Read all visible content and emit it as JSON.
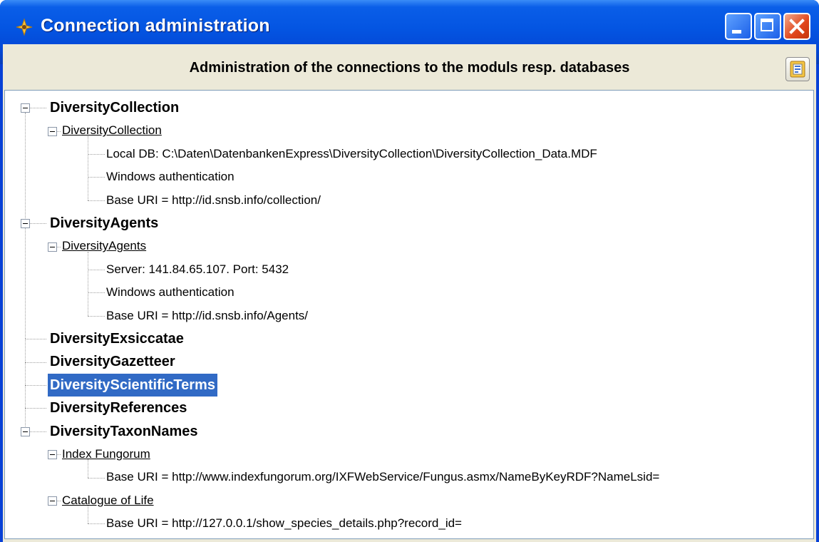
{
  "window": {
    "title": "Connection administration",
    "buttons": {
      "minimize": "minimize-icon",
      "maximize": "maximize-icon",
      "close": "close-icon"
    }
  },
  "header": {
    "text": "Administration of  the connections to the moduls resp. databases",
    "button_icon": "form-icon"
  },
  "tree": [
    {
      "label": "DiversityCollection",
      "expanded": true,
      "children": [
        {
          "label": "DiversityCollection",
          "expanded": true,
          "details": [
            "Local DB: C:\\Daten\\DatenbankenExpress\\DiversityCollection\\DiversityCollection_Data.MDF",
            "Windows authentication",
            "Base URI = http://id.snsb.info/collection/"
          ]
        }
      ]
    },
    {
      "label": "DiversityAgents",
      "expanded": true,
      "children": [
        {
          "label": "DiversityAgents",
          "expanded": true,
          "details": [
            "Server: 141.84.65.107. Port: 5432",
            "Windows authentication",
            "Base URI = http://id.snsb.info/Agents/"
          ]
        }
      ]
    },
    {
      "label": "DiversityExsiccatae"
    },
    {
      "label": "DiversityGazetteer"
    },
    {
      "label": "DiversityScientificTerms",
      "selected": true
    },
    {
      "label": "DiversityReferences"
    },
    {
      "label": "DiversityTaxonNames",
      "expanded": true,
      "children": [
        {
          "label": "Index Fungorum",
          "expanded": true,
          "details": [
            "Base URI = http://www.indexfungorum.org/IXFWebService/Fungus.asmx/NameByKeyRDF?NameLsid="
          ]
        },
        {
          "label": "Catalogue of Life",
          "expanded": true,
          "details": [
            "Base URI = http://127.0.0.1/show_species_details.php?record_id="
          ]
        }
      ]
    }
  ],
  "colors": {
    "selection": "#316ac5",
    "titlebar": "#0455e2"
  }
}
